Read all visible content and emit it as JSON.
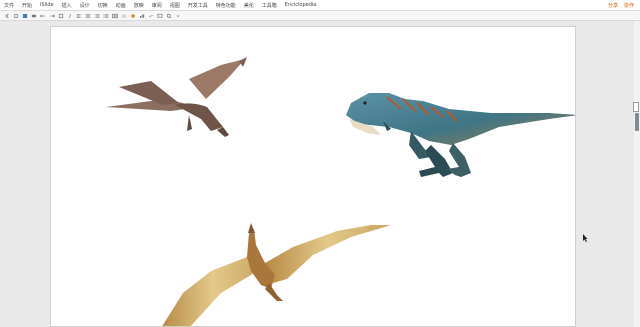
{
  "menubar": {
    "items": [
      "文件",
      "开始",
      "iSlide",
      "插入",
      "设计",
      "切换",
      "动画",
      "放映",
      "审阅",
      "视图",
      "开发工具",
      "特色功能",
      "美化",
      "工具箱",
      "Enciclopedia"
    ],
    "right": {
      "share": "分享",
      "collab": "协作"
    }
  },
  "toolbar": {
    "icons": [
      "arrow-left-icon",
      "refresh-icon",
      "save-icon",
      "print-icon",
      "undo-icon",
      "redo-icon",
      "bold-icon",
      "italic-icon",
      "align-left-icon",
      "align-center-icon",
      "align-right-icon",
      "list-icon",
      "table-icon",
      "image-icon",
      "shape-icon",
      "chart-icon",
      "link-icon",
      "comment-icon",
      "zoom-icon",
      "more-icon"
    ]
  }
}
